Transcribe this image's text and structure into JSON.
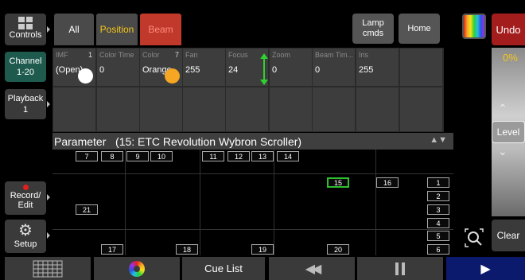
{
  "sidebar": {
    "controls": "Controls",
    "channel": "Channel\n1-20",
    "playback": "Playback\n1",
    "record": "Record/\nEdit",
    "setup": "Setup"
  },
  "tabs": {
    "all": "All",
    "position": "Position",
    "beam": "Beam"
  },
  "top_buttons": {
    "lamp": "Lamp\ncmds",
    "home": "Home",
    "undo": "Undo"
  },
  "colors": {
    "position_text": "#f5c518",
    "beam_text": "#ff6a5a",
    "beam_tab": "#c0392b",
    "undo_bg": "#a31d1d",
    "selected_border": "#2fbf2f",
    "active_channel": "#1e5a4e"
  },
  "params": [
    {
      "label": "IMF",
      "num": "1",
      "value": "(Open)"
    },
    {
      "label": "Color Time",
      "num": "",
      "value": "0"
    },
    {
      "label": "Color",
      "num": "7",
      "value": "Orange"
    },
    {
      "label": "Fan",
      "num": "",
      "value": "255"
    },
    {
      "label": "Focus",
      "num": "",
      "value": "24"
    },
    {
      "label": "Zoom",
      "num": "",
      "value": "0"
    },
    {
      "label": "Beam Tim...",
      "num": "",
      "value": "0"
    },
    {
      "label": "Iris",
      "num": "",
      "value": "255"
    },
    {
      "label": "",
      "num": "",
      "value": ""
    }
  ],
  "parameter_bar": {
    "title": "Parameter   (15: ETC Revolution Wybron Scroller)"
  },
  "right_panel": {
    "level_percent": "0%",
    "level_label": "Level",
    "clear": "Clear"
  },
  "channels": {
    "top_row": [
      "7",
      "8",
      "9",
      "10",
      "11",
      "12",
      "13",
      "14"
    ],
    "selected": "15",
    "row_15_16": [
      "15",
      "16"
    ],
    "left_21": "21",
    "bottom_row": [
      "17",
      "18",
      "19",
      "20"
    ],
    "right_column": [
      "1",
      "2",
      "3",
      "4",
      "5",
      "6"
    ]
  },
  "bottom_bar": {
    "cue_list": "Cue List"
  },
  "icons": [
    "grid-icon",
    "color-wheel-icon",
    "rewind-icon",
    "pause-icon",
    "play-icon",
    "gear-icon",
    "zoom-fit-icon",
    "rainbow-icon",
    "controls-grid-icon"
  ]
}
